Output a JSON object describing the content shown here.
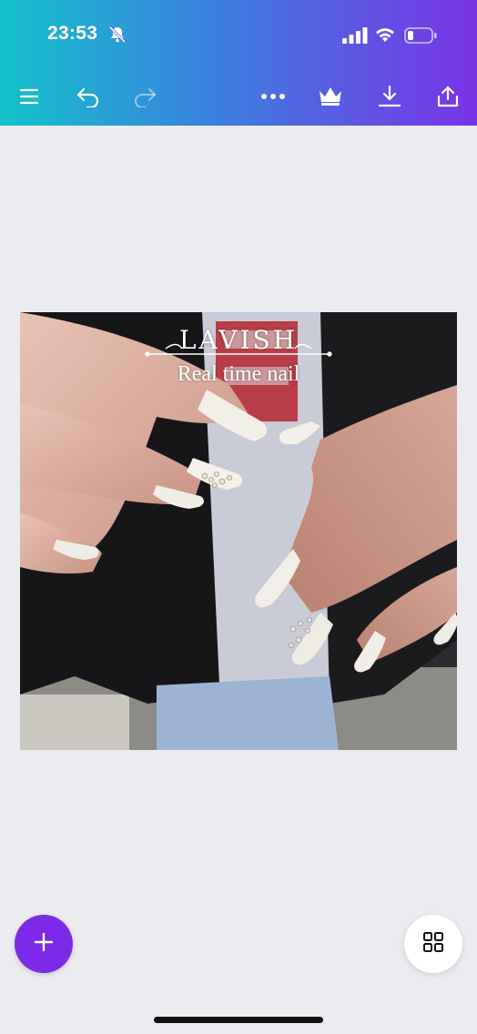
{
  "status_bar": {
    "time": "23:53",
    "icons": [
      "bell-slash-icon",
      "signal-icon",
      "wifi-icon",
      "battery-icon"
    ]
  },
  "toolbar": {
    "left": [
      "menu-icon",
      "undo-icon",
      "redo-icon"
    ],
    "right": [
      "more-icon",
      "crown-icon",
      "download-icon",
      "share-icon"
    ]
  },
  "canvas": {
    "overlay_title": "LAVISH",
    "overlay_subtitle": "Real time nail"
  },
  "fabs": {
    "add_icon": "plus-icon",
    "pages_icon": "grid-icon",
    "add_color": "#7d2ae8"
  },
  "colors": {
    "header_gradient": [
      "#14c2c9",
      "#3b7fe0",
      "#7a33e6"
    ],
    "background": "#ebecf0"
  }
}
